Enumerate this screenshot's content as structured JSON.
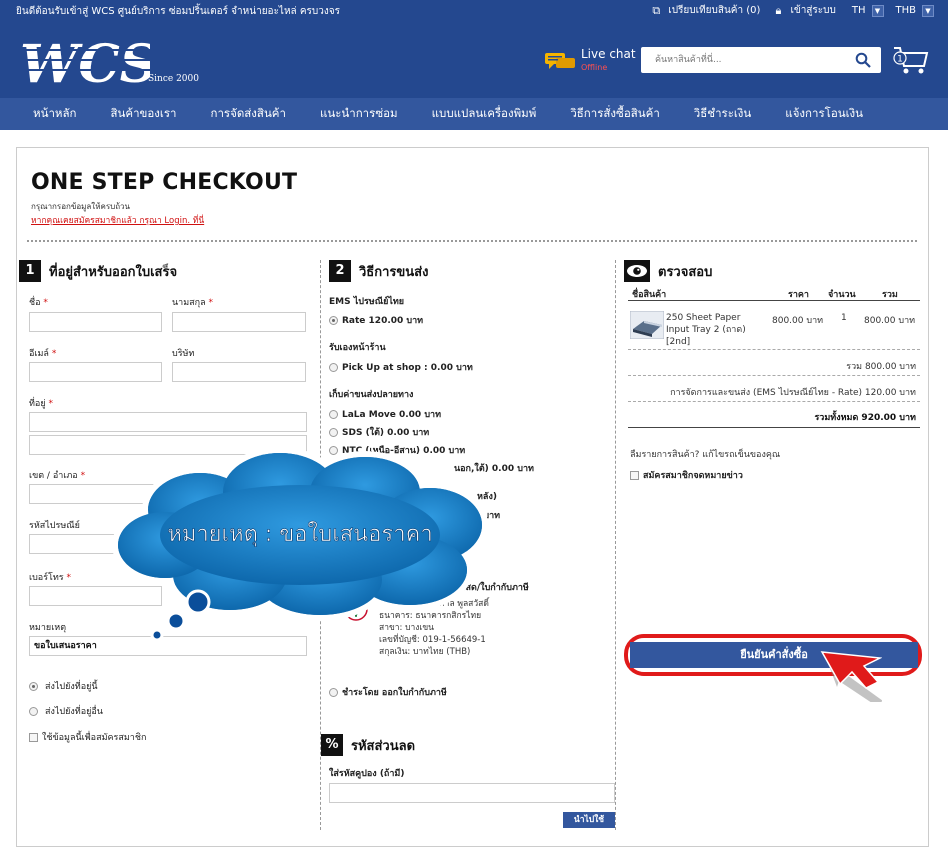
{
  "topbar": {
    "welcome": "ยินดีต้อนรับเข้าสู่ WCS ศูนย์บริการ ซ่อมปริ้นเตอร์ จำหน่ายอะไหล่ ครบวงจร",
    "compare": "เปรียบเทียบสินค้า (0)",
    "login": "เข้าสู่ระบบ",
    "language": "TH",
    "currency": "THB"
  },
  "header": {
    "logo_text": "WCS",
    "since": "Since 2000",
    "livechat": "Live chat",
    "livechat_status": "Offline",
    "search_placeholder": "ค้นหาสินค้าที่นี่...",
    "cart_count": "1"
  },
  "nav": [
    "หน้าหลัก",
    "สินค้าของเรา",
    "การจัดส่งสินค้า",
    "แนะนำการซ่อม",
    "แบบแปลนเครื่องพิมพ์",
    "วิธีการสั่งซื้อสินค้า",
    "วิธีชำระเงิน",
    "แจ้งการโอนเงิน"
  ],
  "checkout": {
    "title": "ONE STEP CHECKOUT",
    "subnote": "กรุณากรอกข้อมูลให้ครบถ้วน",
    "login_link": "หากคุณเคยสมัครสมาชิกแล้ว กรุณา Login. ที่นี่"
  },
  "billing": {
    "num": "1",
    "title": "ที่อยู่สำหรับออกใบเสร็จ",
    "first_name": "ชื่อ",
    "last_name": "นามสกุล",
    "email": "อีเมล์",
    "company": "บริษัท",
    "address": "ที่อยู่",
    "district": "เขต / อำเภอ",
    "postcode": "รหัสไปรษณีย์",
    "phone": "เบอร์โทร",
    "note_label": "หมายเหตุ",
    "note_value": "ขอใบเสนอราคา",
    "ship_same": "ส่งไปยังที่อยู่นี้",
    "ship_other": "ส่งไปยังที่อยู่อื่น",
    "register": "ใช้ข้อมูลนี้เพื่อสมัครสมาชิก"
  },
  "shipping": {
    "num": "2",
    "title": "วิธีการขนส่ง",
    "ems_group": "EMS ไปรษณีย์ไทย",
    "ems_rate": "Rate 120.00 บาท",
    "pickup_group": "รับเองหน้าร้าน",
    "pickup": "Pick Up at shop : 0.00 บาท",
    "collect_group": "เก็บค่าขนส่งปลายทาง",
    "lalamove": "LaLa Move 0.00 บาท",
    "sds": "SDS (ใต้) 0.00 บาท",
    "ntc": "NTC (เหนือ-อีสาน) 0.00 บาท",
    "other_partial": "นอก,ใต้) 0.00 บาท",
    "partial2": "หลัง)",
    "partial3": "0 บาท",
    "payment_partial": "งินสด/ใบกำกับภาษี",
    "account_name": "ชื่อบัญชี: นายไพศาล พูลสวัสดิ์",
    "bank": "ธนาคาร: ธนาคารกสิกรไทย",
    "branch": "สาขา: บางเขน",
    "account_no": "เลขที่บัญชี: 019-1-56649-1",
    "currency": "สกุลเงิน: บาทไทย (THB)",
    "pay_invoice": "ชำระโดย ออกใบกำกับภาษี"
  },
  "coupon": {
    "icon": "%",
    "title": "รหัสส่วนลด",
    "label": "ใส่รหัสคูปอง (ถ้ามี)",
    "apply": "นำไปใช้"
  },
  "review": {
    "title": "ตรวจสอบ",
    "col_product": "ชื่อสินค้า",
    "col_price": "ราคา",
    "col_qty": "จำนวน",
    "col_total": "รวม",
    "item_name_1": "250 Sheet Paper",
    "item_name_2": "Input Tray 2 (ถาด)",
    "item_name_3": "[2nd]",
    "item_price": "800.00 บาท",
    "item_qty": "1",
    "item_total": "800.00 บาท",
    "subtotal": "รวม 800.00 บาท",
    "shipping_fee": "การจัดการและขนส่ง (EMS ไปรษณีย์ไทย - Rate) 120.00 บาท",
    "grand_total": "รวมทั้งหมด 920.00 บาท",
    "forgot": "ลืมรายการสินค้า? แก้ไขรถเข็นของคุณ",
    "newsletter": "สมัครสมาชิกจดหมายข่าว",
    "confirm": "ยืนยันคำสั่งซื้อ"
  },
  "callout": {
    "text": "หมายเหตุ : ขอใบเสนอราคา"
  },
  "colors": {
    "brand": "#24488f",
    "nav": "#33579e",
    "highlight": "#e01a1a",
    "cloud": "#1d7fc4"
  }
}
